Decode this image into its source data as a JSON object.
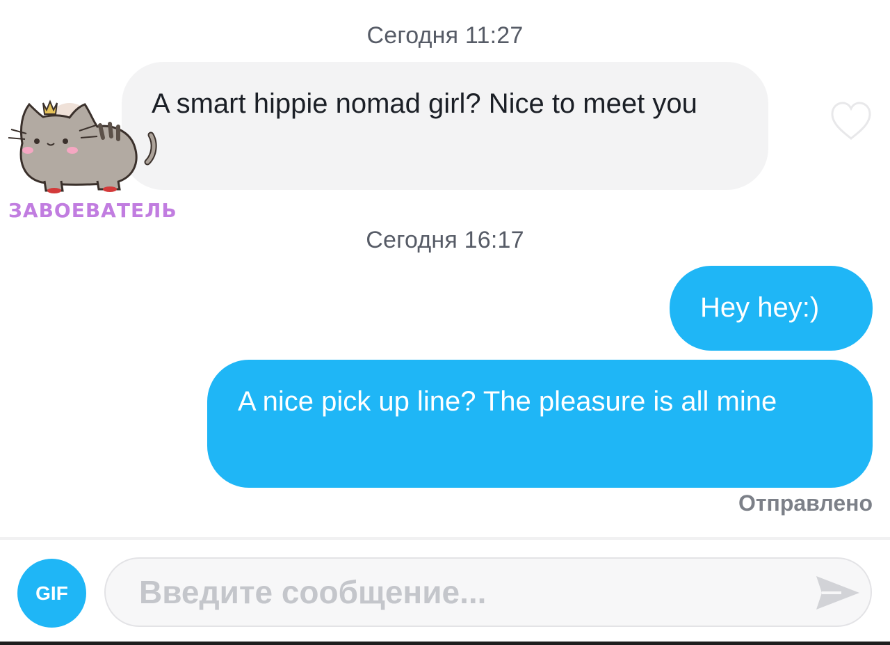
{
  "conversation": {
    "groups": [
      {
        "timestamp": "Сегодня 11:27",
        "messages": [
          {
            "direction": "incoming",
            "text": "A smart hippie nomad girl? Nice to meet you"
          }
        ]
      },
      {
        "timestamp": "Сегодня 16:17",
        "messages": [
          {
            "direction": "outgoing",
            "text": "Hey hey:)"
          },
          {
            "direction": "outgoing",
            "text": "A nice pick up line? The pleasure is all mine"
          }
        ]
      }
    ],
    "status": "Отправлено"
  },
  "sticker": {
    "icon": "pusheen-cat-with-crown-icon",
    "label": "ЗАВОЕВАТЕЛЬ"
  },
  "composer": {
    "gif_label": "GIF",
    "placeholder": "Введите сообщение...",
    "send_icon": "send-arrow-icon"
  },
  "colors": {
    "accent": "#1fb6f6",
    "incoming_bubble": "#f3f3f4",
    "timestamp_text": "#565b66",
    "sticker_label": "#c17de0"
  }
}
